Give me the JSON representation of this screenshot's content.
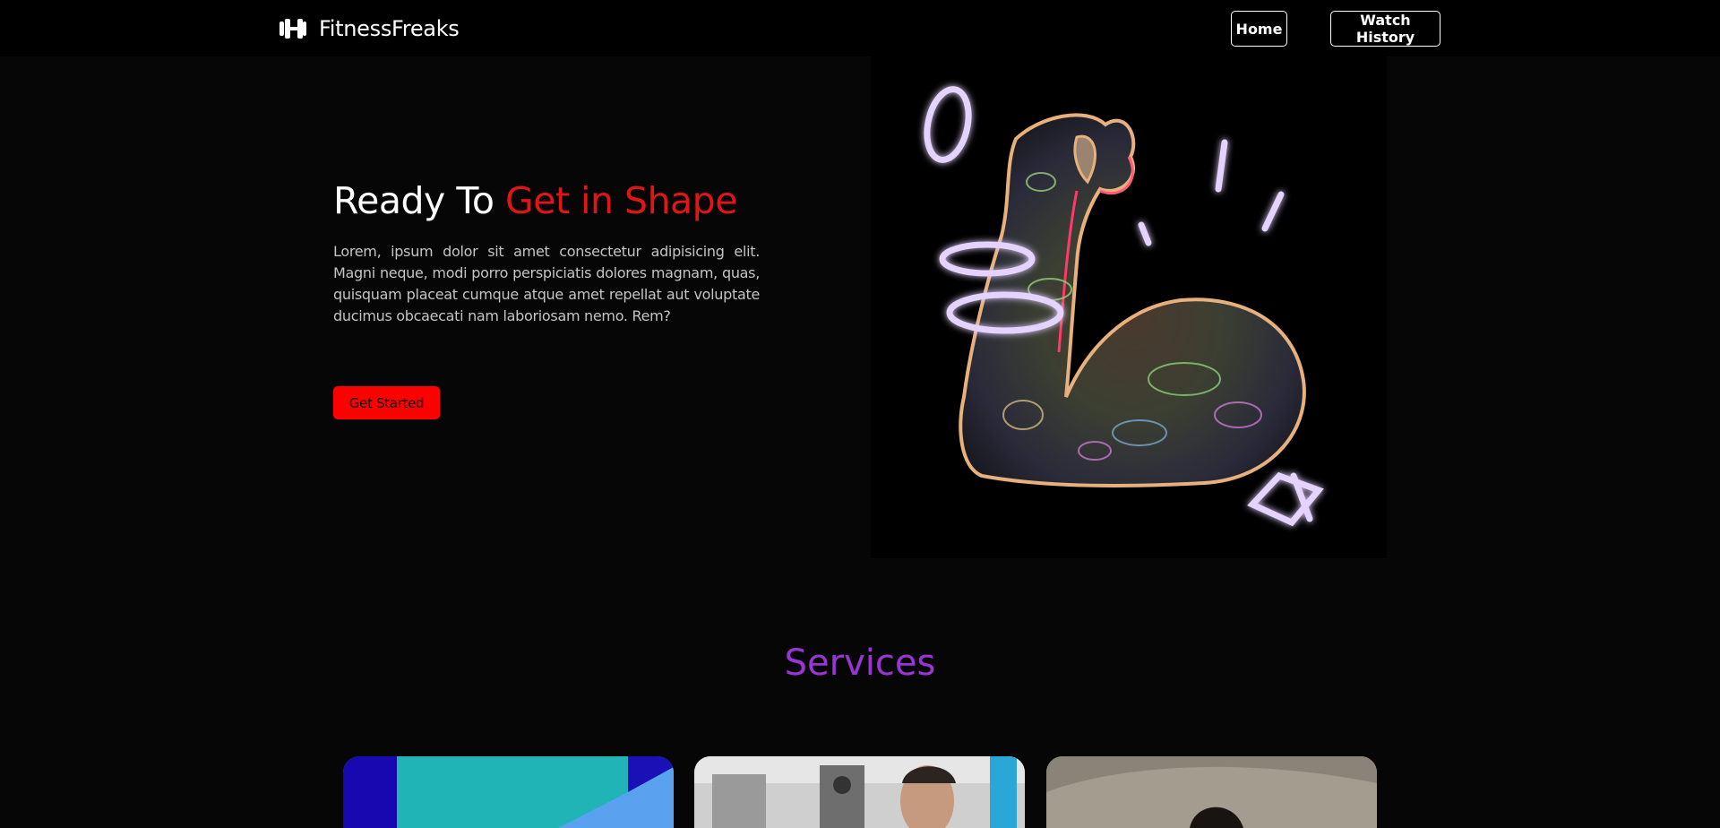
{
  "nav": {
    "brand_name": "FitnessFreaks",
    "brand_icon": "dumbbell-icon",
    "home_label": "Home",
    "history_label": "Watch History"
  },
  "hero": {
    "title_prefix": "Ready To",
    "title_accent": "Get in Shape",
    "description": "Lorem, ipsum dolor sit amet consectetur adipisicing elit. Magni neque, modi porro perspiciatis dolores magnam, quas, quisquam placeat cumque atque amet repellat aut voluptate ducimus obcaecati nam laboriosam nemo. Rem?",
    "cta_label": "Get Started",
    "image": "flexed-bicep-neon-illustration"
  },
  "services": {
    "title": "Services",
    "cards": [
      {
        "image": "abstract-color-blocks"
      },
      {
        "image": "man-at-gym-machine"
      },
      {
        "image": "man-portrait-outdoors"
      }
    ]
  },
  "colors": {
    "background": "#060606",
    "navbar": "#000000",
    "accent_red": "#ff0000",
    "title_red": "#e01515",
    "services_purple": "#9a34d6",
    "neon": "#c9a8ff"
  }
}
